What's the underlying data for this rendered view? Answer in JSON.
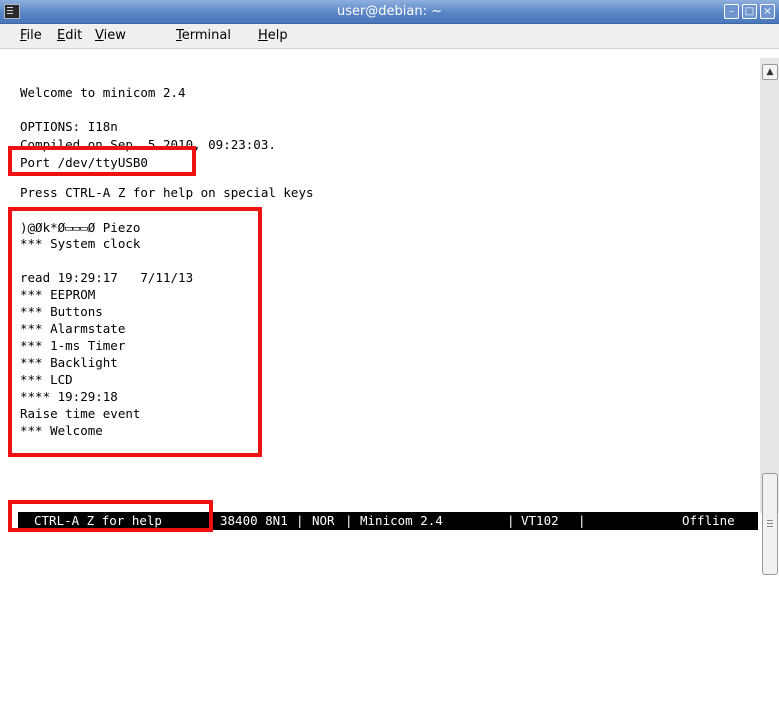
{
  "window": {
    "title": "user@debian: ~",
    "app_icon": "terminal-icon",
    "buttons": [
      "minimize",
      "maximize",
      "close"
    ]
  },
  "menubar": {
    "items": [
      {
        "label": "File",
        "mnemonic": "F"
      },
      {
        "label": "Edit",
        "mnemonic": "E"
      },
      {
        "label": "View",
        "mnemonic": "V"
      },
      {
        "label": "Terminal",
        "mnemonic": "T"
      },
      {
        "label": "Help",
        "mnemonic": "H"
      }
    ]
  },
  "terminal": {
    "lines": [
      "Welcome to minicom 2.4",
      "",
      "OPTIONS: I18n",
      "Compiled on Sep  5 2010, 09:23:03.",
      "Port /dev/ttyUSB0",
      "",
      "Press CTRL-A Z for help on special keys",
      "",
      ")@Øk*Ø▭▭▭Ø Piezo",
      "*** System clock",
      "",
      "read 19:29:17   7/11/13",
      "*** EEPROM",
      "*** Buttons",
      "*** Alarmstate",
      "*** 1-ms Timer",
      "*** Backlight",
      "*** LCD",
      "**** 19:29:18",
      "Raise time event",
      "*** Welcome"
    ]
  },
  "statusbar": {
    "help": "CTRL-A Z for help",
    "port_settings": "38400 8N1",
    "mode": "NOR",
    "program": "Minicom 2.4",
    "emulation": "VT102",
    "connection": "Offline"
  },
  "colors": {
    "titlebar": "#5a86c6",
    "menubar": "#efefee",
    "highlight": "#ee1111",
    "statusbar_bg": "#000000",
    "statusbar_fg": "#ffffff"
  }
}
